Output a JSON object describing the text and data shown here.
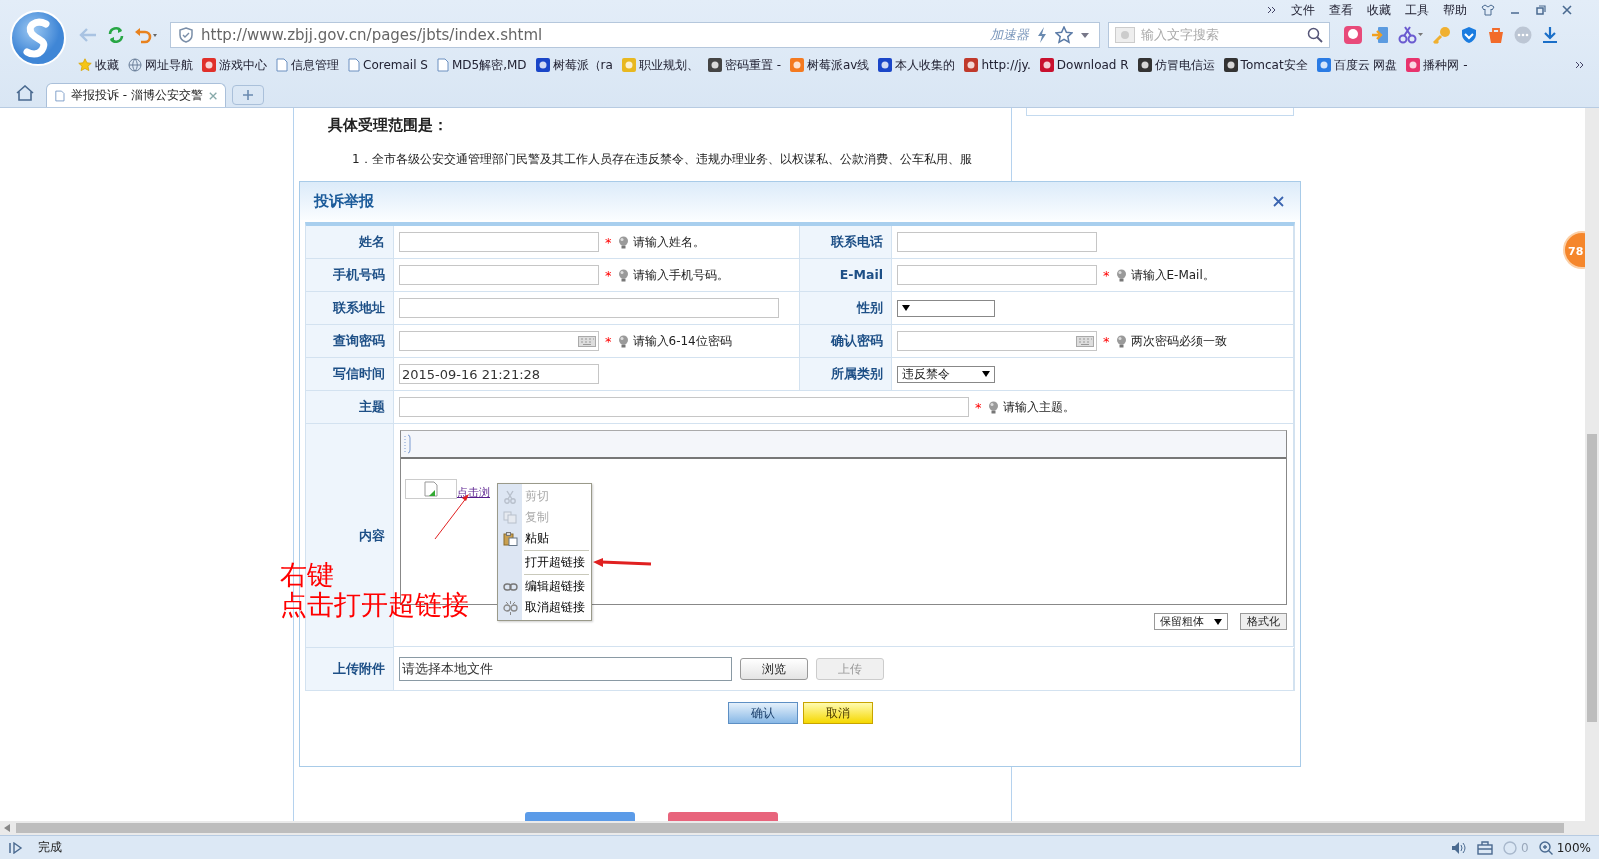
{
  "browser": {
    "menu": [
      "文件",
      "查看",
      "收藏",
      "工具",
      "帮助"
    ],
    "address": "http://www.zbjj.gov.cn/pages/jbts/index.shtml",
    "accelerator": "加速器",
    "search": {
      "placeholder": "输入文字搜索"
    },
    "bookmarks": [
      {
        "label": "收藏",
        "kind": "star"
      },
      {
        "label": "网址导航",
        "kind": "globe"
      },
      {
        "label": "游戏中心",
        "kind": "game"
      },
      {
        "label": "信息管理",
        "kind": "page"
      },
      {
        "label": "Coremail S",
        "kind": "page"
      },
      {
        "label": "MD5解密,MD",
        "kind": "page"
      },
      {
        "label": "树莓派（ra",
        "kind": "paw"
      },
      {
        "label": "职业规划、",
        "kind": "note"
      },
      {
        "label": "密码重置 -",
        "kind": "image"
      },
      {
        "label": "树莓派av线",
        "kind": "taobao"
      },
      {
        "label": "本人收集的",
        "kind": "paw"
      },
      {
        "label": "http://jy.",
        "kind": "seal"
      },
      {
        "label": "Download R",
        "kind": "berry"
      },
      {
        "label": "仿冒电信运",
        "kind": "cloud"
      },
      {
        "label": "Tomcat安全",
        "kind": "cloud"
      },
      {
        "label": "百度云 网盘",
        "kind": "baidu"
      },
      {
        "label": "播种网 -",
        "kind": "bo"
      }
    ],
    "tabs": [
      {
        "label": "举报投诉 - 淄博公安交警",
        "selected": true
      }
    ]
  },
  "page": {
    "heading": "具体受理范围是：",
    "paragraph": "1．全市各级公安交通管理部门民警及其工作人员存在违反禁令、违规办理业务、以权谋私、公款消费、公车私用、服",
    "badge": "78"
  },
  "dialog": {
    "title": "投诉举报",
    "required_mark": "*",
    "rows": [
      {
        "left": {
          "label": "姓名",
          "kind": "text",
          "required": true,
          "hint": "请输入姓名。"
        },
        "right": {
          "label": "联系电话",
          "kind": "text",
          "required": false
        }
      },
      {
        "left": {
          "label": "手机号码",
          "kind": "text",
          "required": true,
          "hint": "请输入手机号码。"
        },
        "right": {
          "label": "E-Mail",
          "kind": "text",
          "required": true,
          "hint": "请输入E-Mail。"
        }
      },
      {
        "left": {
          "label": "联系地址",
          "kind": "wide",
          "required": false
        },
        "right": {
          "label": "性别",
          "kind": "select",
          "required": false
        }
      },
      {
        "left": {
          "label": "查询密码",
          "kind": "password",
          "required": true,
          "hint": "请输入6-14位密码"
        },
        "right": {
          "label": "确认密码",
          "kind": "password",
          "required": true,
          "hint": "两次密码必须一致"
        }
      },
      {
        "left": {
          "label": "写信时间",
          "kind": "text",
          "value": "2015-09-16 21:21:28",
          "required": false
        },
        "right": {
          "label": "所属类别",
          "kind": "select",
          "value": "违反禁令",
          "required": false
        }
      }
    ],
    "subject": {
      "label": "主题",
      "required": true,
      "hint": "请输入主题。"
    },
    "content": {
      "label": "内容",
      "link": "点击浏",
      "font_select": "保留粗体",
      "format_button": "格式化"
    },
    "attachment": {
      "label": "上传附件",
      "value": "请选择本地文件",
      "browse": "浏览",
      "upload": "上传",
      "upload_disabled": true
    },
    "buttons": [
      {
        "label": "确认",
        "kind": "primary"
      },
      {
        "label": "取消",
        "kind": "cancel"
      }
    ]
  },
  "context_menu": {
    "groups": [
      [
        {
          "label": "剪切",
          "kind": "scissors",
          "disabled": true
        },
        {
          "label": "复制",
          "kind": "copy",
          "disabled": true
        },
        {
          "label": "粘贴",
          "kind": "paste",
          "disabled": false
        }
      ],
      [
        {
          "label": "打开超链接",
          "kind": "plain",
          "disabled": false
        }
      ],
      [
        {
          "label": "编辑超链接",
          "kind": "link",
          "disabled": false
        },
        {
          "label": "取消超链接",
          "kind": "unlink",
          "disabled": false
        }
      ]
    ]
  },
  "annotation": {
    "lines": [
      "右键",
      "点击打开超链接"
    ]
  },
  "status_bar": {
    "text": "完成",
    "count": "0",
    "zoom": "100%"
  }
}
